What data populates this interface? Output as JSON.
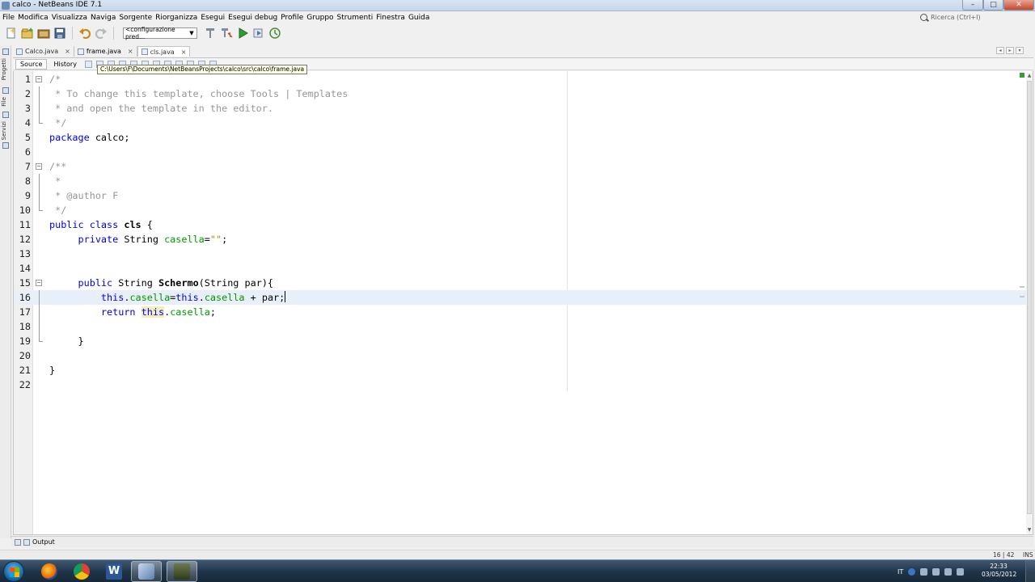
{
  "window": {
    "title": "calco - NetBeans IDE 7.1"
  },
  "menu": [
    "File",
    "Modifica",
    "Visualizza",
    "Naviga",
    "Sorgente",
    "Riorganizza",
    "Esegui",
    "Esegui debug",
    "Profile",
    "Gruppo",
    "Strumenti",
    "Finestra",
    "Guida"
  ],
  "search": {
    "placeholder": "Ricerca (Ctrl+I)"
  },
  "toolbar": {
    "config_value": "<configurazione pred..."
  },
  "side_tabs": [
    "Progetti",
    "File",
    "Servizi"
  ],
  "editor_tabs": [
    {
      "label": "Calco.java",
      "close": "×"
    },
    {
      "label": "frame.java",
      "close": "×"
    },
    {
      "label": "cls.java",
      "close": "×"
    }
  ],
  "editor_subtabs": {
    "source": "Source",
    "history": "History"
  },
  "tooltip": "C:\\Users\\F\\Documents\\NetBeansProjects\\calco\\src\\calco\\frame.java",
  "code_lines": [
    {
      "n": "1",
      "fold": "open"
    },
    {
      "n": "2",
      "fold": "line"
    },
    {
      "n": "3",
      "fold": "line"
    },
    {
      "n": "4",
      "fold": "end"
    },
    {
      "n": "5"
    },
    {
      "n": "6"
    },
    {
      "n": "7",
      "fold": "open"
    },
    {
      "n": "8",
      "fold": "line"
    },
    {
      "n": "9",
      "fold": "line"
    },
    {
      "n": "10",
      "fold": "end"
    },
    {
      "n": "11"
    },
    {
      "n": "12"
    },
    {
      "n": "13"
    },
    {
      "n": "14"
    },
    {
      "n": "15",
      "fold": "open"
    },
    {
      "n": "16",
      "fold": "line",
      "current": true
    },
    {
      "n": "17",
      "fold": "line"
    },
    {
      "n": "18",
      "fold": "line"
    },
    {
      "n": "19",
      "fold": "end"
    },
    {
      "n": "20"
    },
    {
      "n": "21"
    },
    {
      "n": "22"
    }
  ],
  "code": {
    "l1": "/*",
    "l2": " * To change this template, choose Tools | Templates",
    "l3": " * and open the template in the editor.",
    "l4": " */",
    "l5_kw": "package",
    "l5_rest": " calco;",
    "l7": "/**",
    "l8": " *",
    "l9": " * @author F",
    "l10": " */",
    "l11_kw": "public class",
    "l11_name": "cls",
    "l11_rest": " {",
    "l12_kw": "private",
    "l12_type": " String ",
    "l12_field": "casella",
    "l12_eq": "=",
    "l12_str": "\"\"",
    "l12_end": ";",
    "l15_kw": "public",
    "l15_type": " String ",
    "l15_name": "Schermo",
    "l15_rest": "(String par){",
    "l16_this1": "this",
    "l16_dot1": ".",
    "l16_field1": "casella",
    "l16_eq": "=",
    "l16_this2": "this",
    "l16_dot2": ".",
    "l16_field2": "casella",
    "l16_rest": " + par;",
    "l17_kw": "return",
    "l17_this": "this",
    "l17_dot": ".",
    "l17_field": "casella",
    "l17_end": ";",
    "l19": "}",
    "l21": "}"
  },
  "output": {
    "label": "Output"
  },
  "status": {
    "position": "16 | 42",
    "mode": "INS"
  },
  "taskbar": {
    "language": "IT",
    "time": "22:33",
    "date": "03/05/2012"
  },
  "colors": {
    "keyword": "#0000e6",
    "comment": "#969696",
    "field": "#009900",
    "string": "#ce7b00",
    "current_line": "#e9eff8"
  }
}
